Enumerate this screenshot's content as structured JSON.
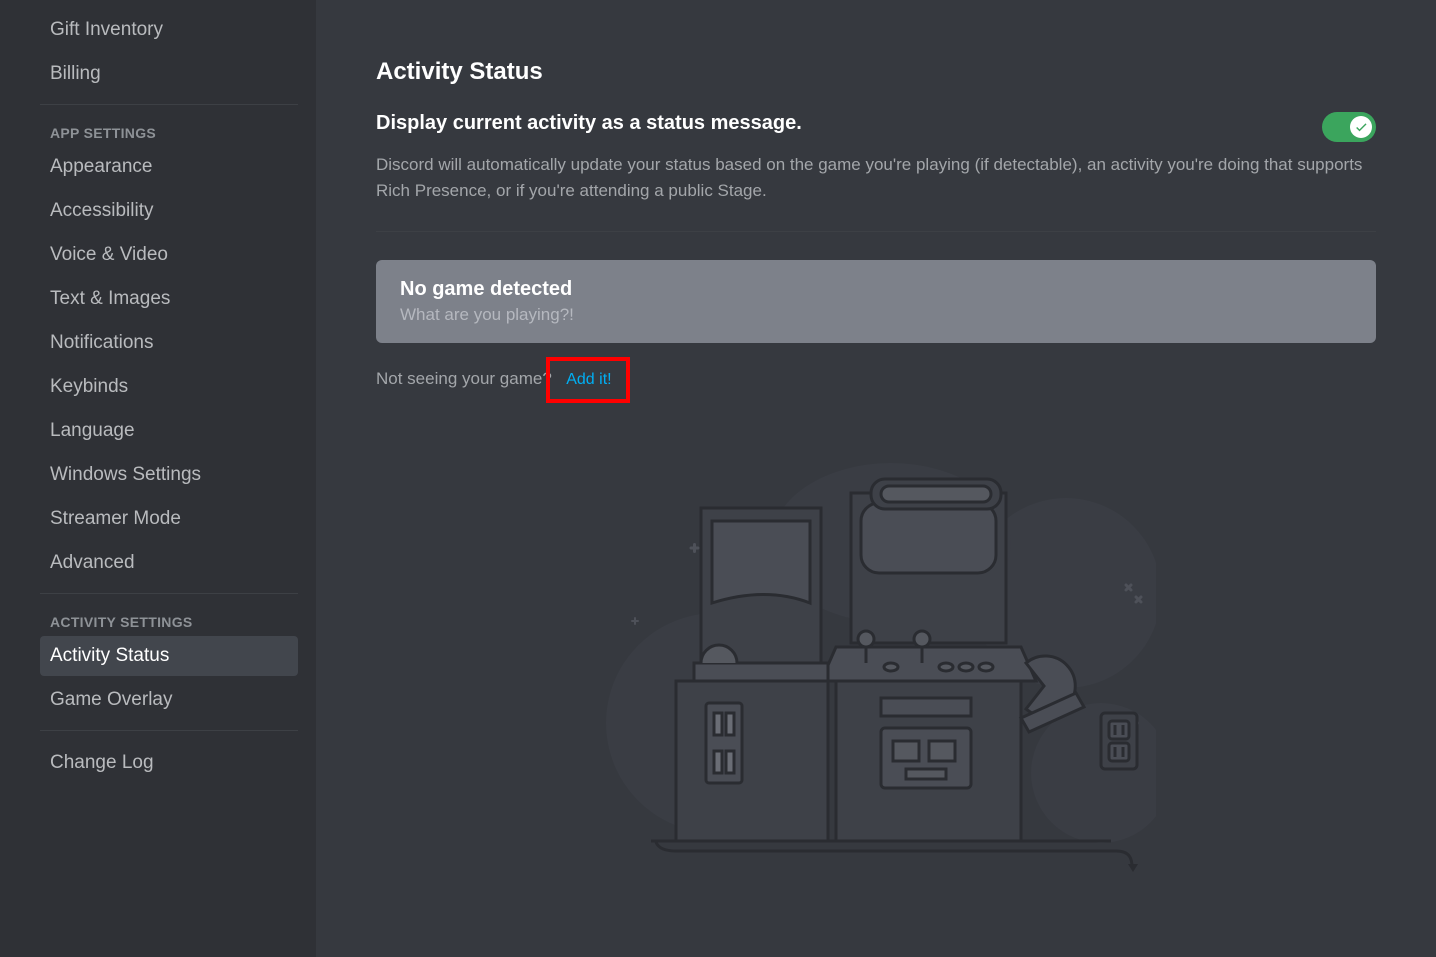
{
  "sidebar": {
    "items_top": [
      {
        "label": "Gift Inventory"
      },
      {
        "label": "Billing"
      }
    ],
    "section_app": "App Settings",
    "items_app": [
      {
        "label": "Appearance"
      },
      {
        "label": "Accessibility"
      },
      {
        "label": "Voice & Video"
      },
      {
        "label": "Text & Images"
      },
      {
        "label": "Notifications"
      },
      {
        "label": "Keybinds"
      },
      {
        "label": "Language"
      },
      {
        "label": "Windows Settings"
      },
      {
        "label": "Streamer Mode"
      },
      {
        "label": "Advanced"
      }
    ],
    "section_activity": "Activity Settings",
    "items_activity": [
      {
        "label": "Activity Status"
      },
      {
        "label": "Game Overlay"
      }
    ],
    "items_bottom": [
      {
        "label": "Change Log"
      }
    ]
  },
  "main": {
    "title": "Activity Status",
    "toggle_label": "Display current activity as a status message.",
    "toggle_desc": "Discord will automatically update your status based on the game you're playing (if detectable), an activity you're doing that supports Rich Presence, or if you're attending a public Stage.",
    "toggle_on": true,
    "card_title": "No game detected",
    "card_sub": "What are you playing?!",
    "not_seeing": "Not seeing your game?",
    "add_it": "Add it!"
  },
  "colors": {
    "accent_green": "#3ba55d",
    "link_blue": "#00aff4",
    "highlight": "#ff0000"
  }
}
